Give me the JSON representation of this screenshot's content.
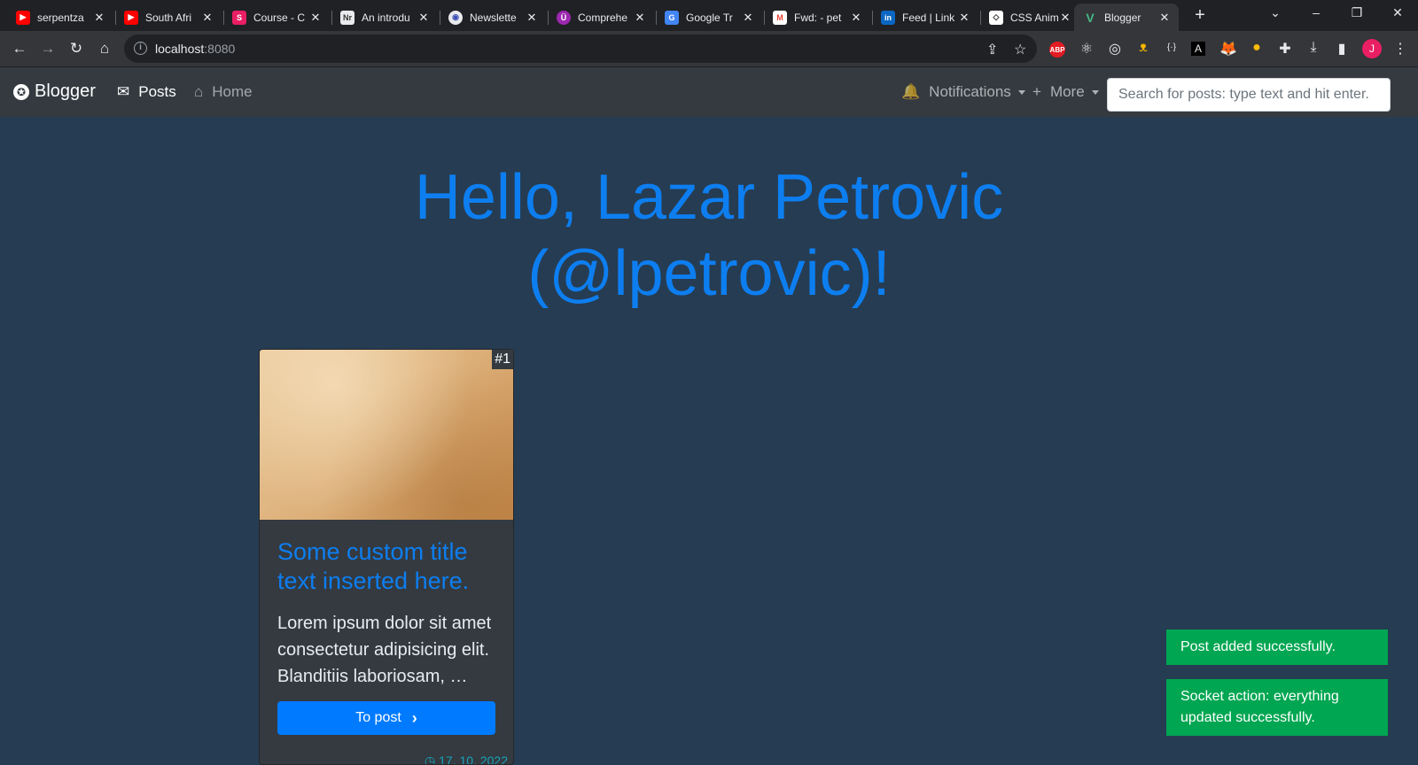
{
  "browser": {
    "tabs": [
      {
        "title": "serpentza",
        "favicon": "youtube-icon",
        "color": "#ff0000"
      },
      {
        "title": "South Afri",
        "favicon": "youtube-icon",
        "color": "#ff0000"
      },
      {
        "title": "Course - C",
        "favicon": "course-icon",
        "color": "#e91e63"
      },
      {
        "title": "An introdu",
        "favicon": "nr-icon",
        "color": "#6b6b9a"
      },
      {
        "title": "Newslette",
        "favicon": "newsletter-icon",
        "color": "#3f51b5"
      },
      {
        "title": "Comprehe",
        "favicon": "comprehend-icon",
        "color": "#9c27b0"
      },
      {
        "title": "Google Tr",
        "favicon": "google-translate-icon",
        "color": "#4285f4"
      },
      {
        "title": "Fwd: - pet",
        "favicon": "gmail-icon",
        "color": "#ea4335"
      },
      {
        "title": "Feed | Link",
        "favicon": "linkedin-icon",
        "color": "#0a66c2"
      },
      {
        "title": "CSS Anim",
        "favicon": "codepen-icon",
        "color": "#222222"
      },
      {
        "title": "Blogger",
        "favicon": "vue-icon",
        "color": "#42b883",
        "active": true
      }
    ],
    "url_host": "localhost",
    "url_port": ":8080",
    "profile_initial": "J"
  },
  "navbar": {
    "brand": "Blogger",
    "posts_label": "Posts",
    "home_label": "Home",
    "notifications_label": "Notifications",
    "more_label": "More",
    "search_placeholder": "Search for posts: type text and hit enter."
  },
  "hero": {
    "line1": "Hello, Lazar Petrovic",
    "line2": "(@lpetrovic)!"
  },
  "post": {
    "number": "#1",
    "title": "Some custom title text inserted here.",
    "excerpt": "Lorem ipsum dolor sit amet consectetur adipisicing elit. Blanditiis laboriosam, …",
    "button_label": "To post",
    "date": "17. 10. 2022"
  },
  "toasts": [
    {
      "message": "Post added successfully."
    },
    {
      "message": "Socket action: everything updated successfully."
    }
  ],
  "colors": {
    "page_bg": "#263c52",
    "accent": "#0d7ef0",
    "toast_success": "#00a651"
  }
}
